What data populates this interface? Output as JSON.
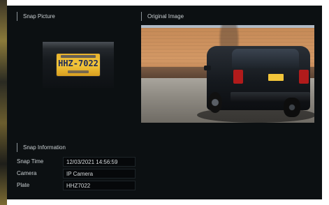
{
  "sections": {
    "snap_picture_title": "Snap Picture",
    "original_image_title": "Original Image",
    "snap_info_title": "Snap Information"
  },
  "snap_picture": {
    "plate_text": "HHZ-7022"
  },
  "snap_info": {
    "fields": [
      {
        "label": "Snap Time",
        "value": "12/03/2021 14:56:59"
      },
      {
        "label": "Camera",
        "value": "IP Camera"
      },
      {
        "label": "Plate",
        "value": "HHZ7022"
      }
    ]
  },
  "colors": {
    "panel_background": "#0c1012",
    "text": "#c9cfd2",
    "field_background": "#06080a",
    "plate_yellow": "#f3c63b"
  }
}
